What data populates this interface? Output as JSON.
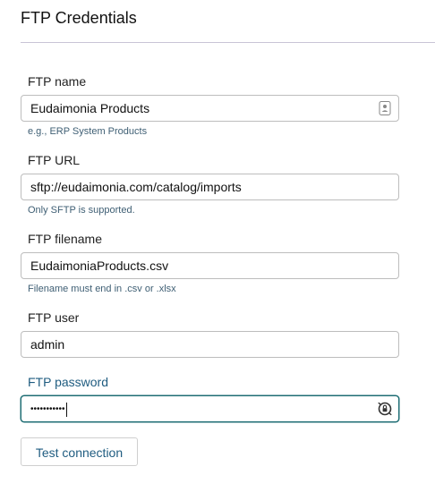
{
  "page": {
    "title": "FTP Credentials"
  },
  "form": {
    "ftp_name": {
      "label": "FTP name",
      "value": "Eudaimonia Products",
      "help": "e.g., ERP System Products",
      "icon": "contact-card-icon"
    },
    "ftp_url": {
      "label": "FTP URL",
      "value": "sftp://eudaimonia.com/catalog/imports",
      "help": "Only SFTP is supported."
    },
    "ftp_filename": {
      "label": "FTP filename",
      "value": "EudaimoniaProducts.csv",
      "help": "Filename must end in .csv or .xlsx"
    },
    "ftp_user": {
      "label": "FTP user",
      "value": "admin"
    },
    "ftp_password": {
      "label": "FTP password",
      "masked_value": "•••••••••••",
      "icon": "password-manager-icon"
    },
    "test_button_label": "Test connection"
  },
  "colors": {
    "accent": "#1f5c80",
    "focus_border": "#1f6e74",
    "divider": "#c9c4d6",
    "help_text": "#3f5f74"
  }
}
